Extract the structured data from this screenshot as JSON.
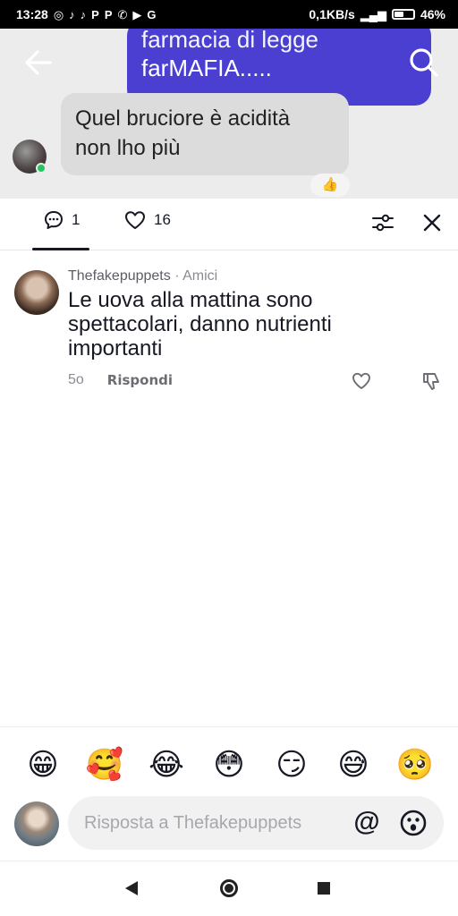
{
  "status_bar": {
    "time": "13:28",
    "app_icons": [
      "whatsapp-icon",
      "tiktok-icon",
      "tiktok-icon",
      "paypal-icon",
      "paypal-icon",
      "viber-icon",
      "youtube-icon",
      "google-icon"
    ],
    "network_speed": "0,1KB/s",
    "battery": "46%"
  },
  "video": {
    "purple_bubble_partial": "farmacia di legge",
    "purple_bubble_text": "farMAFIA.....",
    "gray_bubble_text_line1": "Quel bruciore è acidità",
    "gray_bubble_text_line2": "non lho più",
    "reaction_emoji": "👍"
  },
  "tabs": {
    "comments_count": "1",
    "likes_count": "16"
  },
  "comment": {
    "author": "Thefakepuppets",
    "relation": "· Amici",
    "text": "Le uova alla mattina sono spettacolari, danno nutrienti importanti",
    "age": "5o",
    "reply_label": "Rispondi"
  },
  "emoji_bar": [
    "😁",
    "🥰",
    "😂",
    "😳",
    "😏",
    "😅",
    "🥺"
  ],
  "input": {
    "placeholder": "Risposta a Thefakepuppets",
    "at_symbol": "@"
  },
  "colors": {
    "accent_purple": "#4a3fd0",
    "online_green": "#22c55e",
    "text_primary": "#161823",
    "text_secondary": "#8a8b91"
  }
}
